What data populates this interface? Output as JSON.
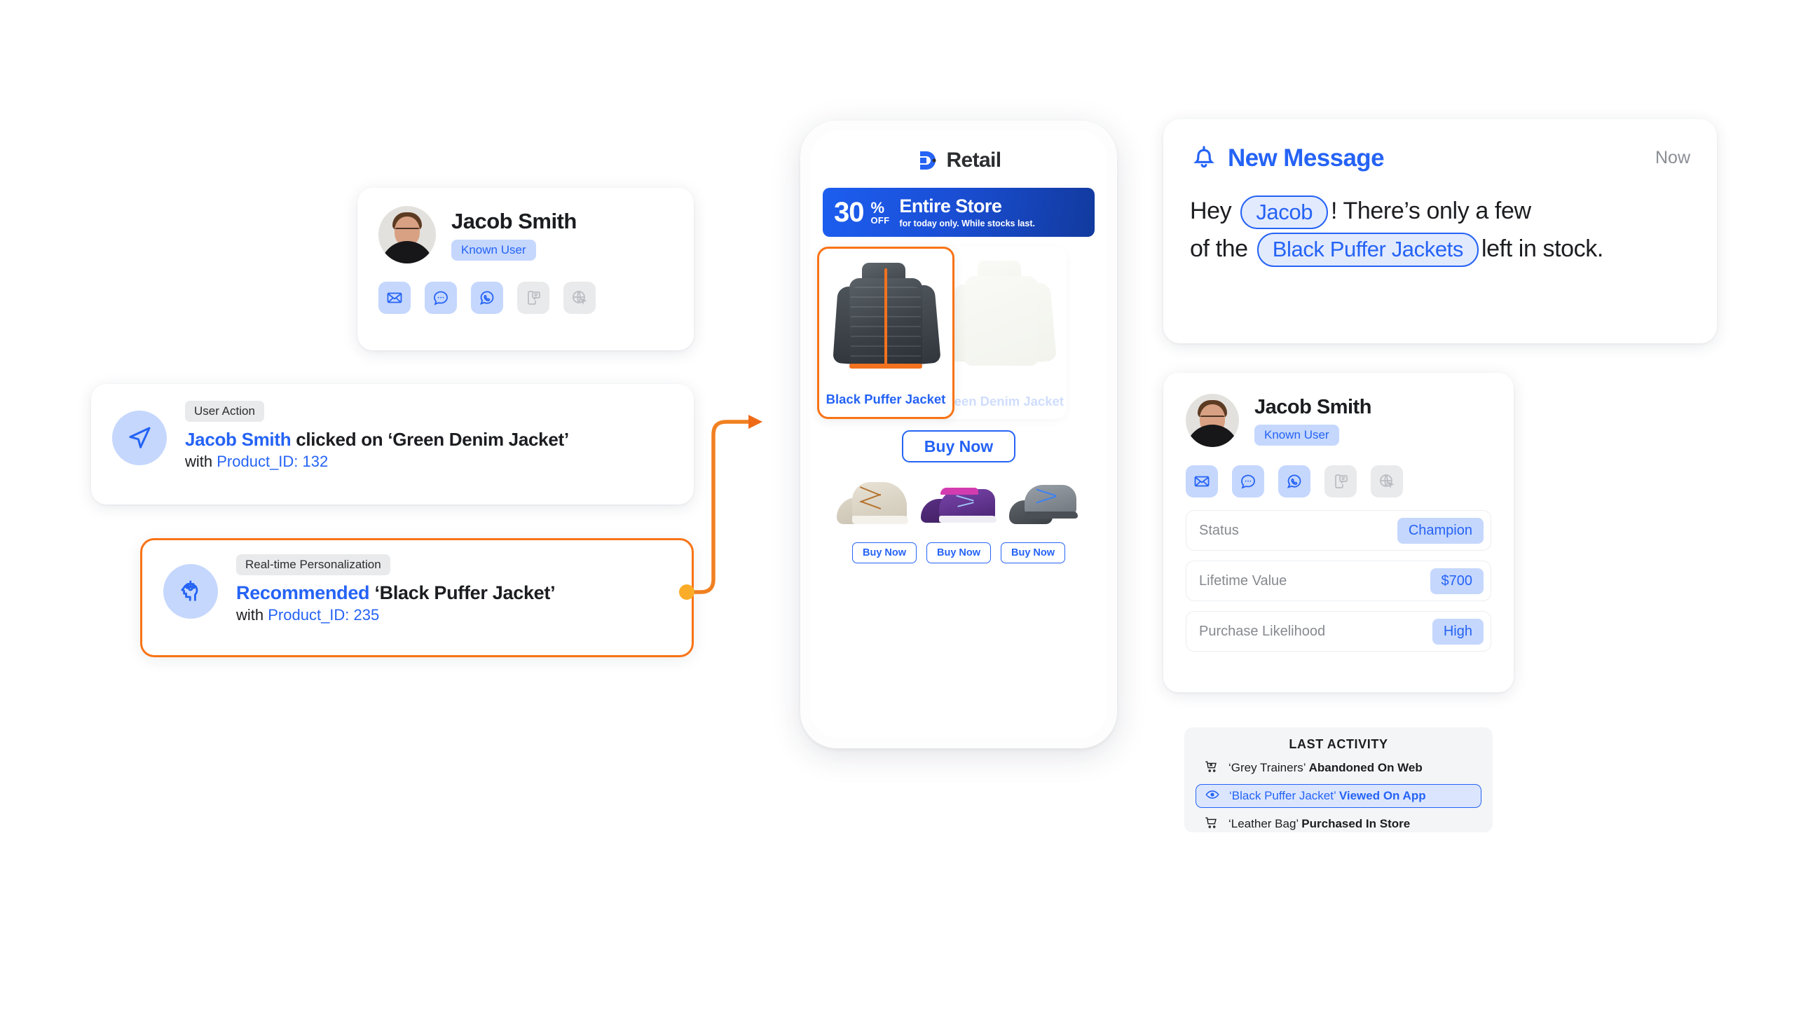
{
  "profile": {
    "name": "Jacob Smith",
    "badge": "Known User",
    "channels": [
      {
        "icon": "email-icon",
        "state": "active"
      },
      {
        "icon": "sms-chat-icon",
        "state": "active"
      },
      {
        "icon": "whatsapp-icon",
        "state": "active"
      },
      {
        "icon": "mobile-push-icon",
        "state": "inactive"
      },
      {
        "icon": "web-push-icon",
        "state": "inactive"
      }
    ]
  },
  "user_action": {
    "tag": "User Action",
    "icon": "paper-plane-icon",
    "actor": "Jacob Smith",
    "verb": " clicked on ",
    "object": "‘Green Denim Jacket’",
    "meta_prefix": "with ",
    "meta_value": "Product_ID: 132"
  },
  "personalization": {
    "tag": "Real-time Personalization",
    "icon": "ai-brain-icon",
    "actor": "Recommended",
    "object": " ‘Black Puffer Jacket’",
    "meta_prefix": "with ",
    "meta_value": "Product_ID: 235",
    "accent": "#f97316"
  },
  "phone": {
    "brand": "Retail",
    "brand_mark": "d-logo-icon",
    "promo": {
      "amount": "30",
      "percent": "%",
      "off": "OFF",
      "headline": "Entire Store",
      "sub": "for today only. While stocks last."
    },
    "products": [
      {
        "name": "Black Puffer Jacket",
        "highlighted": true
      },
      {
        "name": "Green Denim Jacket",
        "highlighted": false
      }
    ],
    "buy_main": "Buy Now",
    "recommendations": [
      {
        "name": "tan-hiking-sneakers",
        "buy": "Buy Now"
      },
      {
        "name": "purple-running-shoes",
        "buy": "Buy Now"
      },
      {
        "name": "grey-blue-trail-shoes",
        "buy": "Buy Now"
      }
    ]
  },
  "message": {
    "icon": "bell-icon",
    "title": "New Message",
    "time": "Now",
    "line1_pre": "Hey ",
    "pill1": "Jacob",
    "line1_post": "! There’s only a few",
    "line2_pre": "of the ",
    "pill2": "Black Puffer Jackets",
    "line2_post": "left in stock."
  },
  "right_profile": {
    "name": "Jacob Smith",
    "badge": "Known User",
    "stats": [
      {
        "label": "Status",
        "value": "Champion"
      },
      {
        "label": "Lifetime Value",
        "value": "$700"
      },
      {
        "label": "Purchase Likelihood",
        "value": "High"
      }
    ],
    "activity_title": "LAST ACTIVITY",
    "activity": [
      {
        "icon": "cart-remove-icon",
        "product": "‘Grey Trainers’ ",
        "action": "Abandoned On Web",
        "highlighted": false
      },
      {
        "icon": "eye-icon",
        "product": "‘Black Puffer Jacket’ ",
        "action": "Viewed On App",
        "highlighted": true
      },
      {
        "icon": "cart-icon",
        "product": "‘Leather Bag’ ",
        "action": "Purchased In Store",
        "highlighted": false
      }
    ]
  },
  "colors": {
    "blue": "#2563f5",
    "light_blue": "#c5d7fd",
    "orange": "#f97316",
    "grey": "#e9eaec"
  }
}
